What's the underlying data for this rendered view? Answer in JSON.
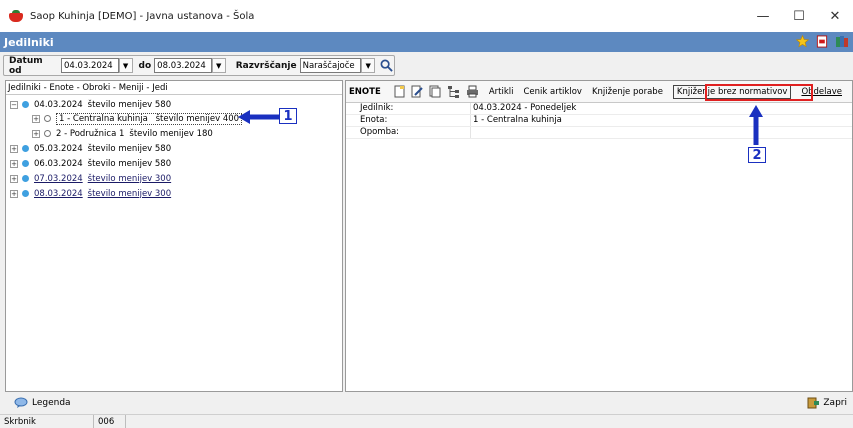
{
  "window": {
    "title": "Saop Kuhinja  [DEMO] - Javna ustanova - Šola",
    "controls": {
      "minimize": "—",
      "maximize": "☐",
      "close": "✕"
    }
  },
  "header": {
    "title": "Jedilniki",
    "icons": [
      "star-icon",
      "pdf-icon",
      "books-icon"
    ]
  },
  "filter": {
    "date_from_label": "Datum od",
    "date_from": "04.03.2024",
    "date_to_label": "do",
    "date_to": "08.03.2024",
    "sort_label": "Razvrščanje",
    "sort_value": "Naraščajoče"
  },
  "tree": {
    "header": "Jedilniki - Enote - Obroki - Meniji - Jedi",
    "root": {
      "date": "04.03.2024",
      "text": "število menijev 580",
      "children": [
        {
          "label": "1 - Centralna kuhinja",
          "text": "število menijev 400"
        },
        {
          "label": "2 - Podružnica 1",
          "text": "število menijev 180"
        }
      ]
    },
    "others": [
      {
        "date": "05.03.2024",
        "text": "število menijev 580"
      },
      {
        "date": "06.03.2024",
        "text": "število menijev 580"
      },
      {
        "date": "07.03.2024",
        "text": "število menijev 300"
      },
      {
        "date": "08.03.2024",
        "text": "število menijev 300"
      }
    ]
  },
  "right": {
    "section_label": "ENOTE",
    "toolbar_links": {
      "artikli": "Artikli",
      "cenik": "Cenik artiklov",
      "porabe": "Knjiženje porabe",
      "brez": "Knjiženje brez normativov",
      "obdelave": "Obdelave"
    },
    "info": {
      "jedilnik_key": "Jedilnik:",
      "jedilnik_val": "04.03.2024 - Ponedeljek",
      "enota_key": "Enota:",
      "enota_val": "1 - Centralna kuhinja",
      "opomba_key": "Opomba:",
      "opomba_val": ""
    }
  },
  "annotations": {
    "one": "1",
    "two": "2"
  },
  "bottom": {
    "legend": "Legenda",
    "close": "Zapri"
  },
  "status": {
    "user": "Skrbnik",
    "code": "006"
  },
  "colors": {
    "header_bg": "#5d89c0",
    "annotation_blue": "#1a30c0",
    "highlight_red": "#e02020",
    "tree_dot": "#3fa0e0"
  }
}
